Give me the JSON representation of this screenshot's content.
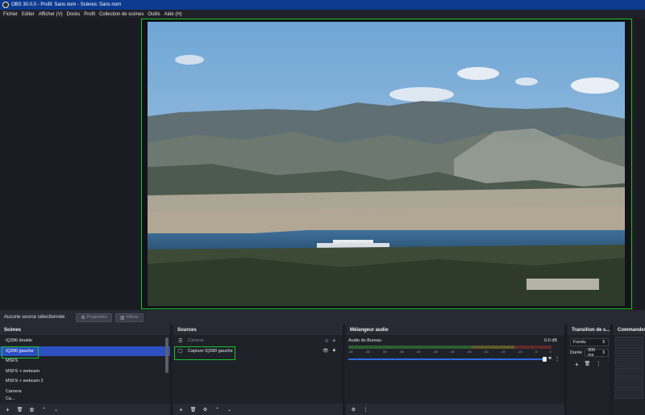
{
  "window": {
    "title": "OBS 30.0.0 - Profil: Sans nom - Scènes: Sans nom"
  },
  "menu": [
    "Fichier",
    "Editer",
    "Afficher (V)",
    "Docks",
    "Profil",
    "Collection de scènes",
    "Outils",
    "Aide (H)"
  ],
  "context_bar": {
    "status": "Aucune source sélectionnée",
    "properties_label": "Propriétés",
    "filters_label": "Filtres"
  },
  "scenes": {
    "title": "Scènes",
    "items": [
      "IQ390 double",
      "IQ390 gauche",
      "MSFS",
      "MSFS + webcam",
      "MSFS + webcam 2",
      "Camera",
      "Ca..."
    ],
    "selected_index": 1
  },
  "sources": {
    "title": "Sources",
    "items": [
      {
        "label": "Camera",
        "icon": "list-icon",
        "visible": false,
        "locked": true
      },
      {
        "label": "Capture IQ390 gauche",
        "icon": "monitor-icon",
        "visible": true,
        "locked": true
      }
    ]
  },
  "mixer": {
    "title": "Mélangeur audio",
    "track_name": "Audio du Bureau",
    "level": "0.0 dB",
    "ticks": [
      "-60",
      "-55",
      "-50",
      "-45",
      "-40",
      "-35",
      "-30",
      "-25",
      "-20",
      "-15",
      "-10",
      "-5",
      "0"
    ],
    "volume_fraction": 1.0
  },
  "transitions": {
    "title": "Transition de s...",
    "selected": "Fondu",
    "duration_label": "Durée",
    "duration_value": "300 ms"
  },
  "commands": {
    "title": "Commandes"
  },
  "colors": {
    "accent_selection": "#2c4fc2",
    "highlight_green": "#18c228",
    "titlebar": "#0d3a8f"
  }
}
